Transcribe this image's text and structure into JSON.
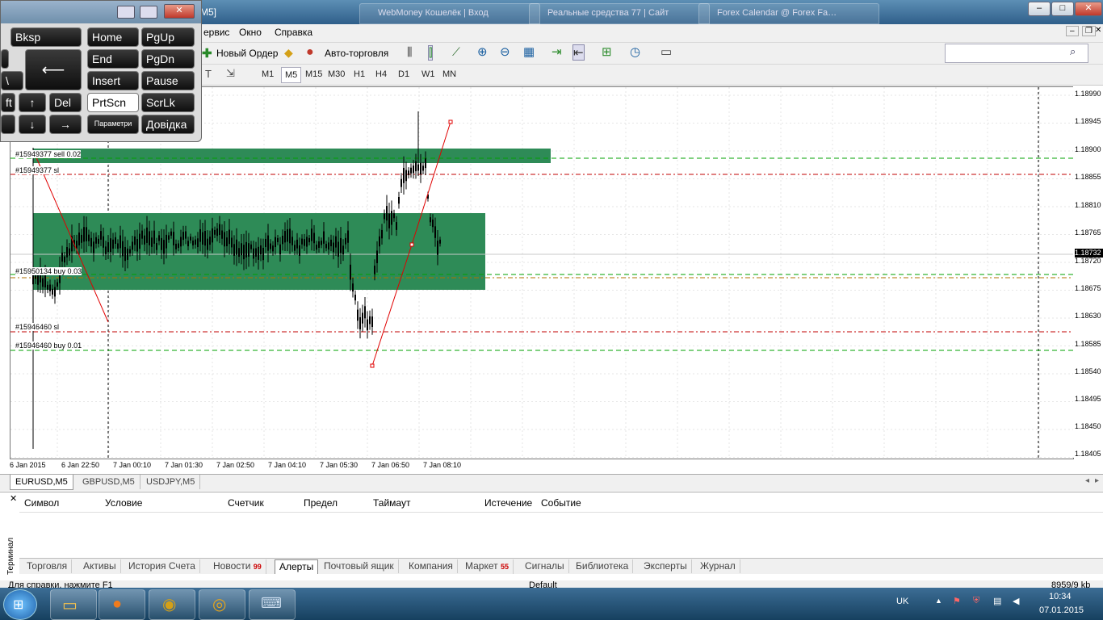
{
  "window": {
    "title_fragment": "M5]",
    "browser_tabs": [
      "WebMoney Кошелёк | Вход",
      "Реальные средства 77 | Сайт",
      "Forex Calendar @ Forex Fa…"
    ]
  },
  "menu": {
    "items": [
      "ервис",
      "Окно",
      "Справка"
    ]
  },
  "toolbar": {
    "new_order": "Новый Ордер",
    "autotrading": "Авто-торговля",
    "timeframes": [
      "M1",
      "M5",
      "M15",
      "M30",
      "H1",
      "H4",
      "D1",
      "W1",
      "MN"
    ],
    "active_timeframe": "M5",
    "search_placeholder": ""
  },
  "chart": {
    "symbol": "EURUSD",
    "timeframe": "M5",
    "price_axis_ticks": [
      "1.18990",
      "1.18945",
      "1.18900",
      "1.18855",
      "1.18810",
      "1.18765",
      "1.18720",
      "1.18675",
      "1.18630",
      "1.18585",
      "1.18540",
      "1.18495",
      "1.18450",
      "1.18405"
    ],
    "current_price": "1.18732",
    "time_axis_ticks": [
      "6 Jan 2015",
      "6 Jan 22:50",
      "7 Jan 00:10",
      "7 Jan 01:30",
      "7 Jan 02:50",
      "7 Jan 04:10",
      "7 Jan 05:30",
      "7 Jan 06:50",
      "7 Jan 08:10"
    ],
    "order_labels": [
      "#15949377 sell 0.02",
      "#15949377 sl",
      "#15950134 buy 0.03",
      "#15946460 sl",
      "#15946460 buy 0.01"
    ],
    "colors": {
      "zone": "#2e8b57",
      "sl_line": "#c00000",
      "tp_line": "#00a000",
      "trendline": "#e00000"
    }
  },
  "chart_tabs": [
    "EURUSD,M5",
    "GBPUSD,M5",
    "USDJPY,M5"
  ],
  "terminal": {
    "label": "Терминал",
    "columns": [
      "Символ",
      "Условие",
      "Счетчик",
      "Предел",
      "Таймаут",
      "Истечение",
      "Событие"
    ],
    "tabs": [
      {
        "label": "Торговля",
        "count": ""
      },
      {
        "label": "Активы",
        "count": ""
      },
      {
        "label": "История Счета",
        "count": ""
      },
      {
        "label": "Новости",
        "count": "99"
      },
      {
        "label": "Алерты",
        "count": ""
      },
      {
        "label": "Почтовый ящик",
        "count": ""
      },
      {
        "label": "Компания",
        "count": ""
      },
      {
        "label": "Маркет",
        "count": "55"
      },
      {
        "label": "Сигналы",
        "count": ""
      },
      {
        "label": "Библиотека",
        "count": ""
      },
      {
        "label": "Эксперты",
        "count": ""
      },
      {
        "label": "Журнал",
        "count": ""
      }
    ],
    "active_tab": "Алерты"
  },
  "statusbar": {
    "help": "Для справки, нажмите F1",
    "profile": "Default",
    "traffic": "8959/9 kb"
  },
  "taskbar": {
    "language": "UK",
    "time": "10:34",
    "date": "07.01.2015"
  },
  "keyboard": {
    "keys": [
      "Bksp",
      "Home",
      "PgUp",
      "End",
      "PgDn",
      "Insert",
      "Pause",
      "Del",
      "PrtScn",
      "ScrLk",
      "Параметри",
      "Довідка",
      "↑",
      "↓",
      "→",
      "\\",
      "ft"
    ]
  }
}
